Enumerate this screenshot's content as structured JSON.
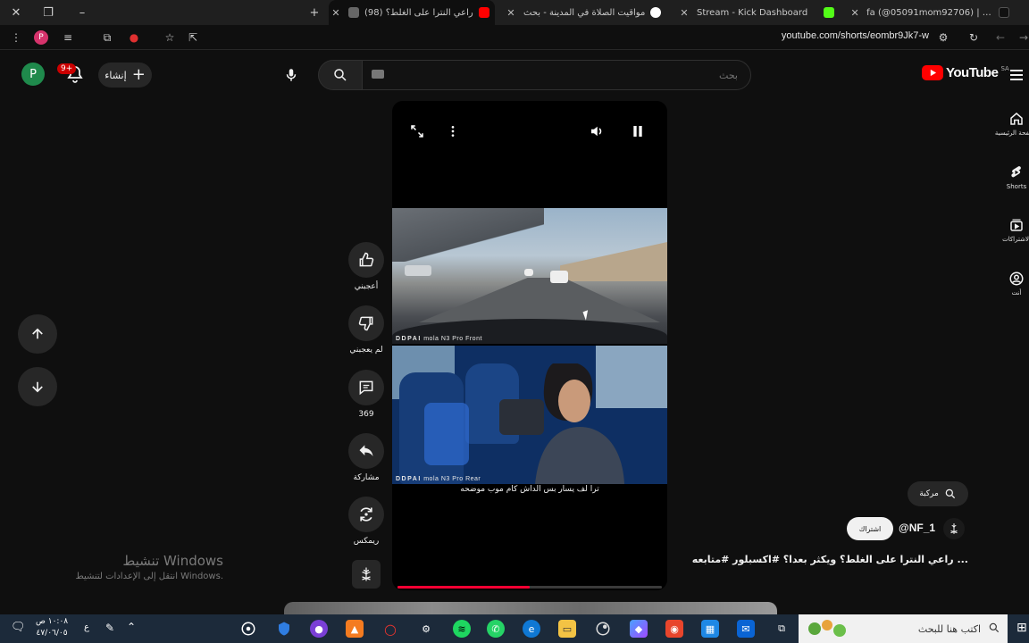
{
  "browser": {
    "tabs": [
      {
        "title": "(98) راعي النترا على الغلط؟",
        "active": true
      },
      {
        "title": "مواقيت الصلاة في المدينة - بحث",
        "active": false
      },
      {
        "title": "Stream - Kick Dashboard",
        "active": false
      },
      {
        "title": "fa (@05091mom92706) | TikTok",
        "active": false
      }
    ],
    "url": "youtube.com/shorts/eombr9Jk7-w",
    "profile_initial": "P"
  },
  "header": {
    "avatar_initial": "P",
    "notification_badge": "9+",
    "create_label": "إنشاء",
    "search_placeholder": "بحث",
    "logo_text": "YouTube",
    "logo_region": "SA"
  },
  "rail": {
    "items": [
      {
        "label": "الصفحة الرئيسية",
        "icon": "home-icon"
      },
      {
        "label": "Shorts",
        "icon": "shorts-icon"
      },
      {
        "label": "الاشتراكات",
        "icon": "subscriptions-icon"
      },
      {
        "label": "أنت",
        "icon": "you-icon"
      }
    ]
  },
  "player": {
    "front_cam_brand": "DDPAI",
    "front_cam_label": "mola N3 Pro Front",
    "rear_cam_brand": "DDPAI",
    "rear_cam_label": "mola N3 Pro Rear",
    "caption": "ترا لف يسار بس الداش كام موب موضحه",
    "progress": 0.5
  },
  "actions": {
    "like_label": "أعجبني",
    "dislike_label": "لم يعجبني",
    "comments_count": "369",
    "share_label": "مشاركة",
    "remix_label": "ريمكس"
  },
  "meta": {
    "search_pill_label": "مركبة",
    "subscribe_label": "اشتراك",
    "channel_handle": "@NF_1",
    "video_title": "راعي النترا على الغلط؟ ويكثر بعدا؟ #اكسبلور #متابعه ..."
  },
  "watermark": {
    "line1": "تنشيط Windows",
    "line2": "انتقل إلى الإعدادات لتنشيط Windows."
  },
  "taskbar": {
    "search_placeholder": "اكتب هنا للبحث",
    "time": "١٠:٠٨ ص",
    "date": "٤٧/٠٦/٠٥",
    "lang": "ع"
  },
  "colors": {
    "accent": "#ff0000",
    "background": "#0f0f0f",
    "progress": "#ff0033"
  }
}
